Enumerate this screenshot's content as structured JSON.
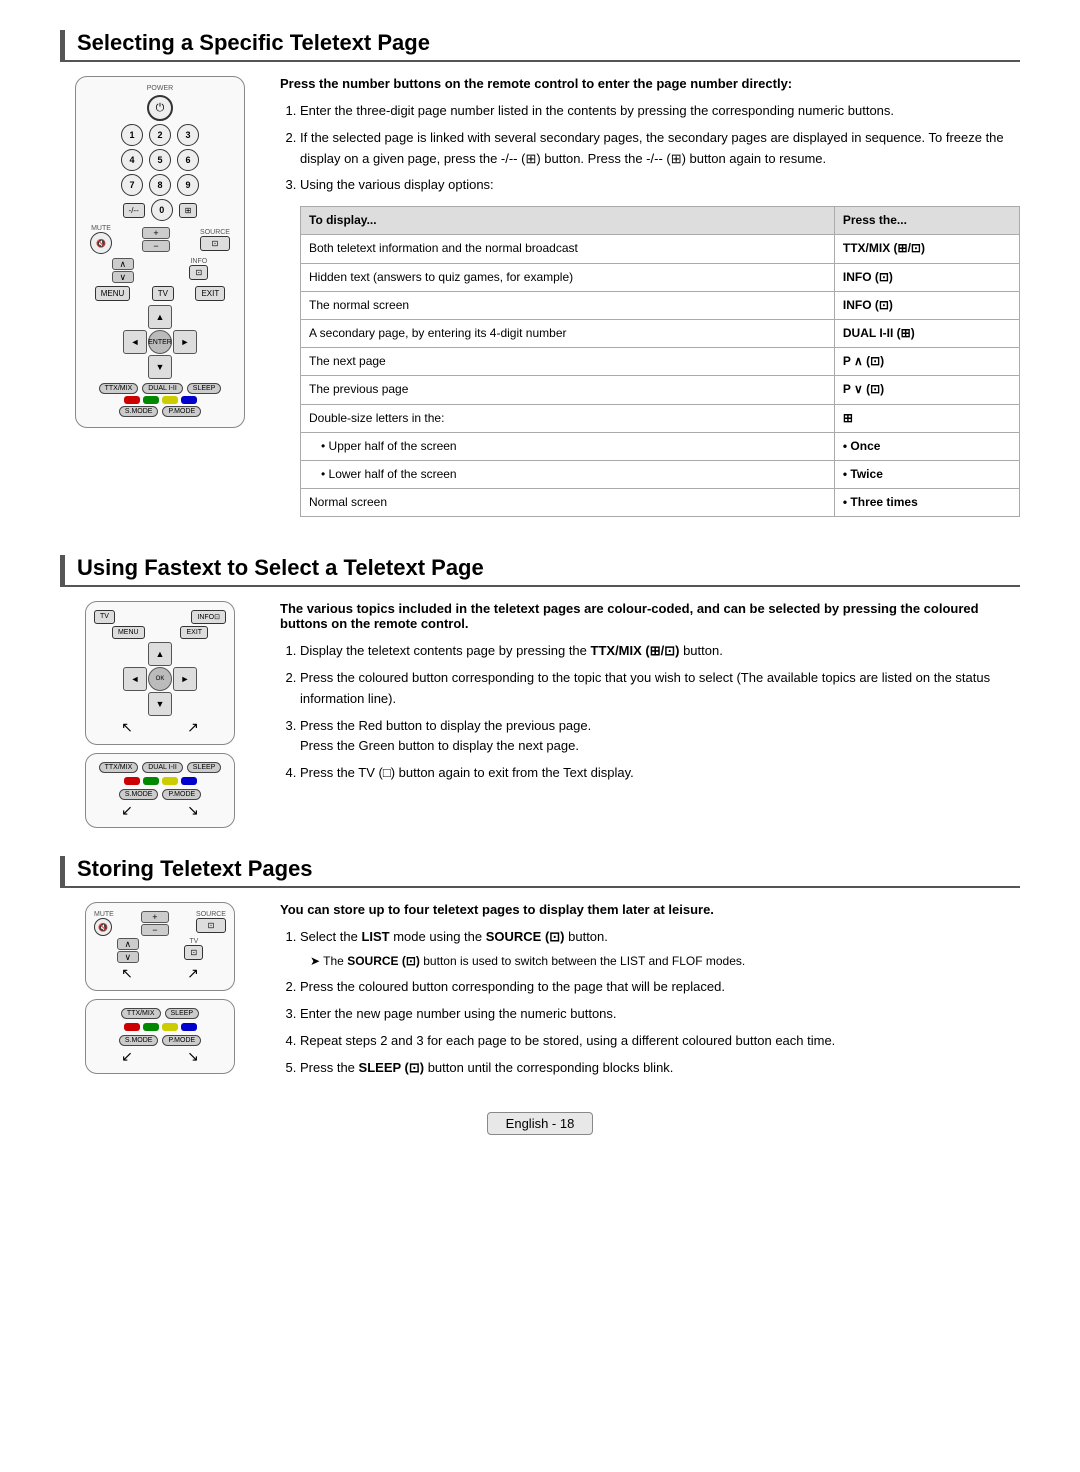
{
  "sections": [
    {
      "id": "selecting",
      "title": "Selecting a Specific Teletext Page",
      "intro_bold": "Press the number buttons on the remote control to enter the page number directly:",
      "steps": [
        "Enter the three-digit page number listed in the contents by pressing the corresponding numeric buttons.",
        "If the selected page is linked with several secondary pages, the secondary pages are displayed in sequence. To freeze the display on a given page, press the -/-- (⊞) button. Press the -/-- (⊞) button again to resume.",
        "Using the various display options:"
      ],
      "table": {
        "headers": [
          "To display...",
          "Press the..."
        ],
        "rows": [
          [
            "Both teletext information and the normal broadcast",
            "TTX/MIX (⊞/⊡)"
          ],
          [
            "Hidden text (answers to quiz games, for example)",
            "INFO (⊡)"
          ],
          [
            "The normal screen",
            "INFO (⊡)"
          ],
          [
            "A secondary page, by entering its 4-digit number",
            "DUAL I-II (⊞)"
          ],
          [
            "The next page",
            "P ∧ (⊡)"
          ],
          [
            "The previous page",
            "P ∨ (⊡)"
          ],
          [
            "Double-size letters in the:",
            "⊞"
          ],
          [
            "• Upper half of the screen",
            "• Once"
          ],
          [
            "• Lower half of the screen",
            "• Twice"
          ],
          [
            "Normal screen",
            "• Three times"
          ]
        ]
      }
    },
    {
      "id": "fastext",
      "title": "Using Fastext to Select a Teletext Page",
      "intro_bold": "The various topics included in the teletext pages are colour-coded, and can be selected by pressing the coloured buttons on the remote control.",
      "steps": [
        {
          "num": 1,
          "text": "Display the teletext contents page by pressing the TTX/MIX (⊞/⊡) button."
        },
        {
          "num": 2,
          "text": "Press the coloured button corresponding to the topic that you wish to select (The available topics are listed on the status information line)."
        },
        {
          "num": 3,
          "text": "Press the Red button to display the previous page.\nPress the Green button to display the next page."
        },
        {
          "num": 4,
          "text": "Press the TV (□) button again to exit from the Text display."
        }
      ]
    },
    {
      "id": "storing",
      "title": "Storing Teletext Pages",
      "intro_bold": "You can store up to four teletext pages to display them later at leisure.",
      "steps": [
        {
          "num": 1,
          "text": "Select the LIST mode using the SOURCE (⊡) button.",
          "sub": "➤ The SOURCE (⊡) button is used to switch between the LIST and FLOF modes."
        },
        {
          "num": 2,
          "text": "Press the coloured button corresponding to the page that will be replaced."
        },
        {
          "num": 3,
          "text": "Enter the new page number using the numeric buttons."
        },
        {
          "num": 4,
          "text": "Repeat steps 2 and 3 for each page to be stored, using a different coloured button each time."
        },
        {
          "num": 5,
          "text": "Press the SLEEP (⊡) button until the corresponding blocks blink."
        }
      ]
    }
  ],
  "footer": {
    "label": "English - 18"
  }
}
